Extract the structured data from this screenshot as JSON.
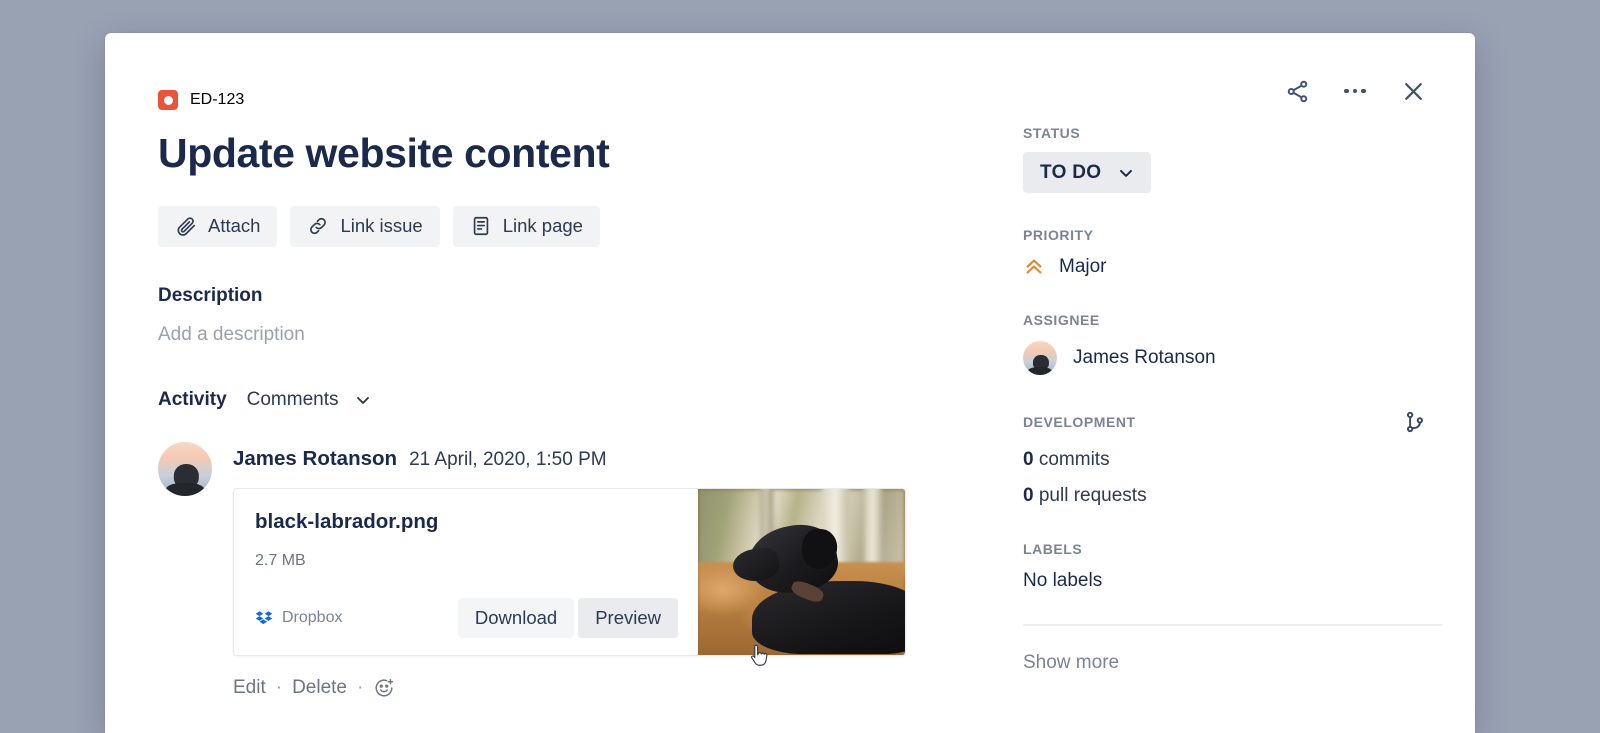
{
  "window": {
    "background_color": "#99a2b3",
    "modal_background": "#ffffff"
  },
  "header": {
    "issue_type_icon": "bug-icon",
    "issue_key": "ED-123",
    "title": "Update website content",
    "actions": [
      {
        "name": "share-button",
        "icon": "share-icon"
      },
      {
        "name": "more-options-button",
        "icon": "ellipsis-icon"
      },
      {
        "name": "close-button",
        "icon": "close-icon"
      }
    ]
  },
  "toolbar": {
    "buttons": [
      {
        "label": "Attach",
        "icon": "paperclip-icon"
      },
      {
        "label": "Link issue",
        "icon": "link-icon"
      },
      {
        "label": "Link page",
        "icon": "page-icon"
      }
    ]
  },
  "description": {
    "heading": "Description",
    "placeholder": "Add a description"
  },
  "activity": {
    "heading": "Activity",
    "filter_label": "Comments",
    "filter_icon": "chevron-down-icon",
    "comment": {
      "author": "James Rotanson",
      "timestamp": "21 April, 2020, 1:50 PM",
      "avatar": "user-avatar",
      "attachment": {
        "filename": "black-labrador.png",
        "filesize": "2.7 MB",
        "source_label": "Dropbox",
        "source_icon": "dropbox-icon",
        "source_color": "#0f6ae0",
        "download_label": "Download",
        "preview_label": "Preview",
        "thumbnail_alt": "black-labrador-photo"
      },
      "actions": {
        "edit_label": "Edit",
        "separator": "·",
        "delete_label": "Delete",
        "reaction_icon": "add-reaction-icon"
      }
    }
  },
  "sidebar": {
    "status": {
      "label": "STATUS",
      "value": "TO DO",
      "icon": "chevron-down-icon",
      "background": "#e9ebef"
    },
    "priority": {
      "label": "PRIORITY",
      "value": "Major",
      "icon": "priority-major-icon",
      "color": "#e08a2e"
    },
    "assignee": {
      "label": "ASSIGNEE",
      "value": "James Rotanson",
      "avatar": "user-avatar"
    },
    "development": {
      "label": "DEVELOPMENT",
      "icon": "branch-icon",
      "commits_count": "0",
      "commits_label": "commits",
      "pull_requests_count": "0",
      "pull_requests_label": "pull requests"
    },
    "labels": {
      "label": "LABELS",
      "value": "No labels"
    },
    "show_more_label": "Show more"
  }
}
